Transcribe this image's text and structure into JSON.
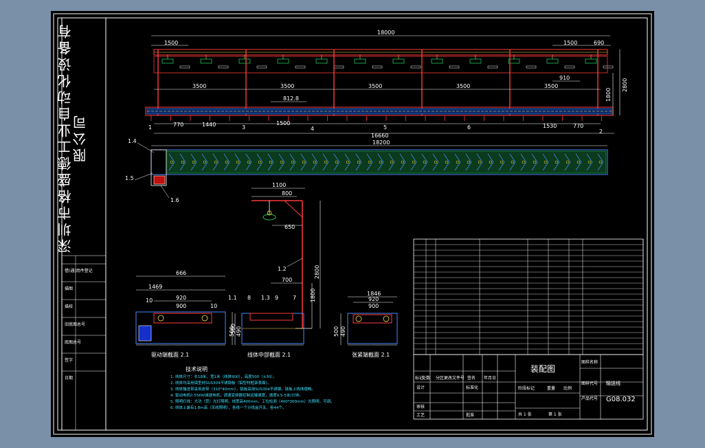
{
  "company_name": "深圳市格盛德工业自动化设备有限公司",
  "colors": {
    "background": "#7a8fa8",
    "sheet": "#000000",
    "frame": "#ffffff",
    "dimension": "#ffffff",
    "structure": "#ff3b3b",
    "conveyor": "#4a8cff",
    "fill_green": "#1fc75a",
    "yellow": "#ffe04a",
    "cyan_text": "#3fe0ff"
  },
  "top_view": {
    "overall_length": "18000",
    "left_segment": "1500",
    "right_segment": "1500",
    "right_end": "690",
    "spans": [
      "3500",
      "3500",
      "3500",
      "3500",
      "3500"
    ],
    "inner_span": "910",
    "mid_dim": "812.8",
    "bottom_dims": [
      "770",
      "1440",
      "1500",
      "1530",
      "770"
    ],
    "conveyor_length": "16660",
    "height_total": "2800",
    "height_lower": "1800",
    "part_labels": [
      "1",
      "3",
      "4",
      "5",
      "6",
      "2"
    ]
  },
  "plan_view": {
    "length": "18200",
    "labels": [
      "1.4",
      "1.5",
      "1.6"
    ]
  },
  "boom_view": {
    "width_outer": "1100",
    "width_inner": "800",
    "arm": "650",
    "base": "700",
    "height_total": "2800",
    "height_lower": "1800",
    "label": "1.2"
  },
  "section_views": [
    {
      "caption": "驱动端截面 2.1",
      "dims": [
        "666",
        "1469",
        "920",
        "900"
      ],
      "heights": [
        "500"
      ],
      "labels": [
        "10",
        "10"
      ]
    },
    {
      "caption": "线体中部截面 2.1",
      "dims": [
        "700"
      ],
      "heights": [
        "500",
        "490"
      ],
      "labels": [
        "1.1",
        "8",
        "1.3",
        "9",
        "7"
      ]
    },
    {
      "caption": "张紧端截面 2.1",
      "dims": [
        "1846",
        "920",
        "900"
      ],
      "heights": [
        "500",
        "490"
      ],
      "labels": []
    }
  ],
  "notes": {
    "title": "技术说明",
    "lines": [
      "1. 线体尺寸：长18米，宽1米（线体900），高度500（±30）。",
      "2. 线体均采用铝型材SUS304不锈钢板（铝型材框架表面）。",
      "3. 线体输送带采用皮带（310*40mm），链板采用SUS304不锈钢，链板上线体顺畅。",
      "4. 驱动电机0.55KW减速电机，调速变频器控制运输速度，速度0.5-5米/分钟。",
      "5. 照明灯线：大功（荧）光灯照明，线宽高400mm，工位检测（400*300mm）光照明，可调。",
      "6. 线体上装有1.8m高（吊线照明），各线一个分线盒开关，各44个。"
    ]
  },
  "title_block": {
    "drawing_title": "装配图",
    "drawing_number": "G08.032",
    "name_value": "输送线",
    "header_cells": [
      "标记",
      "处数",
      "分区",
      "更改文件号",
      "签名",
      "年月日"
    ],
    "role_cells": [
      "设计",
      "标准化",
      "审核",
      "工艺",
      "批准"
    ],
    "right_labels": [
      "图样名称",
      "图样代号",
      "产品代号"
    ],
    "mid_labels": [
      "阶段标记",
      "重量",
      "比例"
    ],
    "sheet_info": [
      "共 1 张",
      "第 1 张"
    ]
  },
  "left_table": {
    "rows": [
      "借(通)用件登记",
      "描图",
      "描校",
      "旧底图总号",
      "底图总号",
      "签字",
      "日期"
    ]
  },
  "bom": {
    "row_count": 21
  }
}
